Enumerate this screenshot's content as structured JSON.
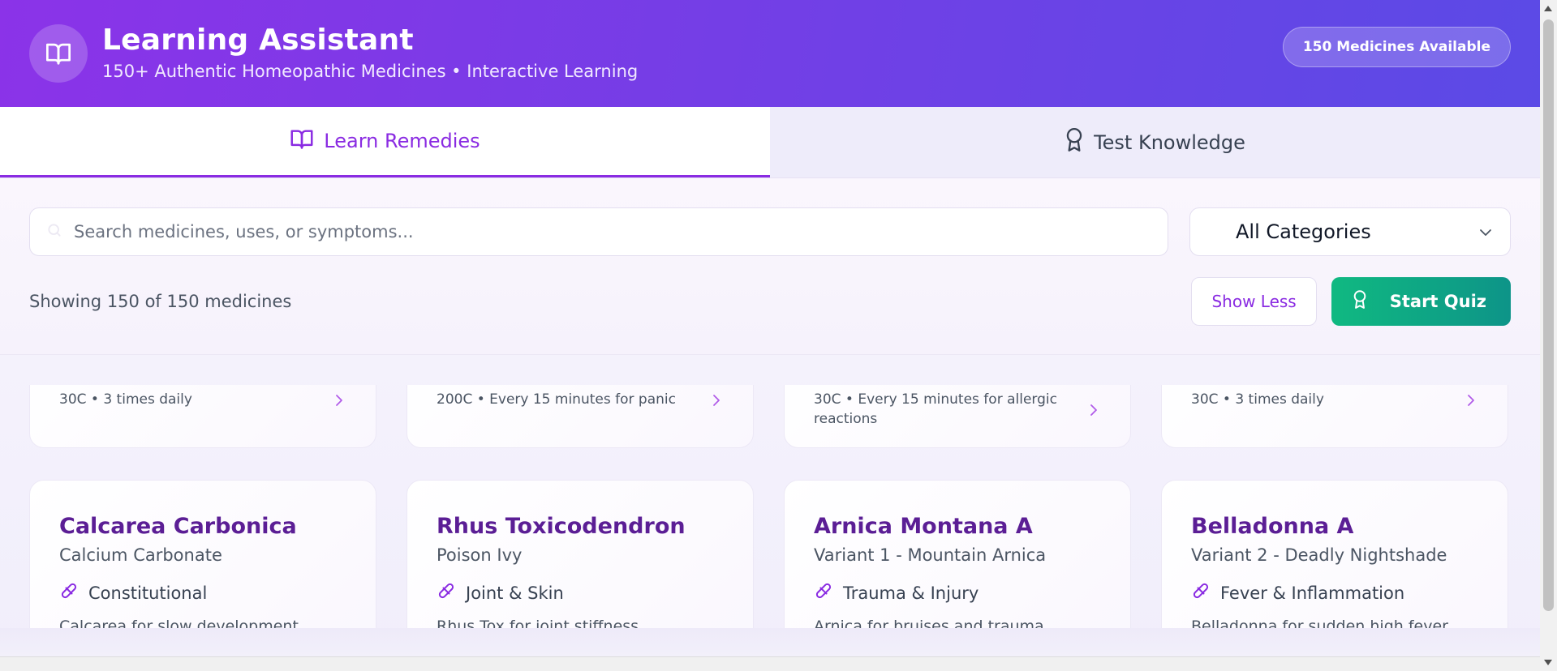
{
  "header": {
    "title": "Learning Assistant",
    "subtitle": "150+ Authentic Homeopathic Medicines • Interactive Learning",
    "badge": "150 Medicines Available",
    "logo_icon": "book-open-icon"
  },
  "tabs": [
    {
      "label": "Learn Remedies",
      "icon": "book-open-icon",
      "active": true
    },
    {
      "label": "Test Knowledge",
      "icon": "award-icon",
      "active": false
    }
  ],
  "search": {
    "placeholder": "Search medicines, uses, or symptoms...",
    "value": ""
  },
  "category_select": {
    "value": "All Categories"
  },
  "results": {
    "showing": "Showing 150 of 150 medicines"
  },
  "actions": {
    "show_less": "Show Less",
    "start_quiz": "Start Quiz"
  },
  "cards_top": [
    {
      "dosage": "30C • 3 times daily"
    },
    {
      "dosage": "200C • Every 15 minutes for panic"
    },
    {
      "dosage": "30C • Every 15 minutes for allergic reactions"
    },
    {
      "dosage": "30C • 3 times daily"
    }
  ],
  "cards": [
    {
      "name": "Calcarea Carbonica",
      "common": "Calcium Carbonate",
      "category": "Constitutional",
      "desc": "Calcarea for slow development"
    },
    {
      "name": "Rhus Toxicodendron",
      "common": "Poison Ivy",
      "category": "Joint & Skin",
      "desc": "Rhus Tox for joint stiffness"
    },
    {
      "name": "Arnica Montana A",
      "common": "Variant 1 - Mountain Arnica",
      "category": "Trauma & Injury",
      "desc": "Arnica for bruises and trauma"
    },
    {
      "name": "Belladonna A",
      "common": "Variant 2 - Deadly Nightshade",
      "category": "Fever & Inflammation",
      "desc": "Belladonna for sudden high fever"
    }
  ],
  "colors": {
    "accent": "#8a2be2",
    "header_gradient_start": "#8b33e8",
    "header_gradient_end": "#5b4ae6",
    "quiz_green": "#10b981",
    "card_title": "#5b1e95"
  }
}
